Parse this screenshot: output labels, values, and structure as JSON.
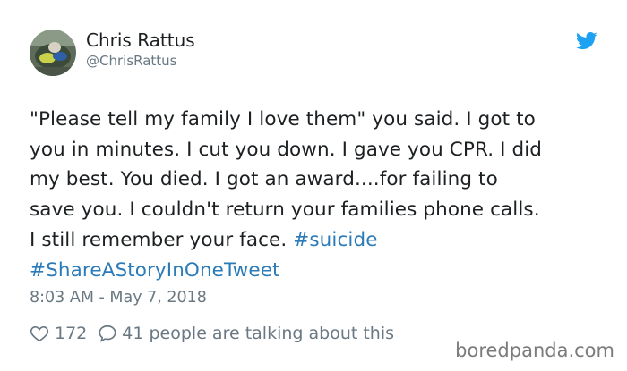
{
  "author": {
    "name": "Chris Rattus",
    "handle": "@ChrisRattus",
    "avatar_icon": "profile-photo"
  },
  "tweet": {
    "lines": [
      "\"Please tell my family I love them\" you said. I got to",
      "you in minutes. I cut you down. I gave you CPR. I did",
      "my best. You died. I got an award....for failing to",
      "save you. I couldn't return your families phone calls.",
      "I still remember your face."
    ],
    "hashtags": [
      "#suicide",
      "#ShareAStoryInOneTweet"
    ],
    "timestamp": "8:03 AM - May 7, 2018"
  },
  "stats": {
    "likes": "172",
    "replies_text": "41 people are talking about this"
  },
  "icons": {
    "brand": "twitter-bird-icon",
    "like": "heart-icon",
    "reply": "speech-bubble-icon"
  },
  "colors": {
    "text": "#1c2022",
    "secondary": "#697882",
    "hashtag": "#2b7bb9",
    "brand": "#1da1f2"
  },
  "watermark": "boredpanda.com"
}
